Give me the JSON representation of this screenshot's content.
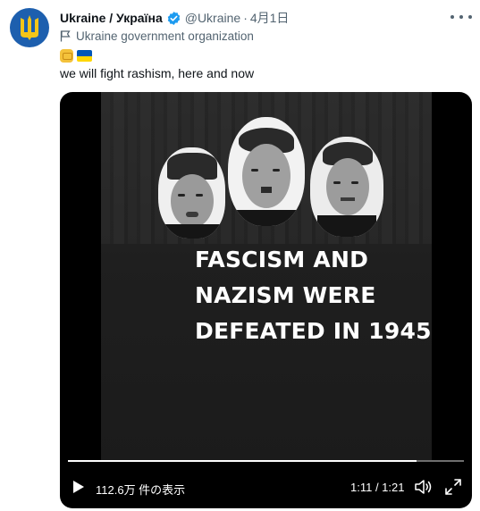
{
  "tweet": {
    "display_name": "Ukraine / Україна",
    "handle": "@Ukraine",
    "separator": "·",
    "date": "4月1日",
    "account_label": "Ukraine government organization",
    "text": "we will fight rashism, here and now",
    "emojis": [
      "raised-fist-emoji",
      "ukraine-flag-emoji"
    ]
  },
  "media": {
    "headline": [
      "FASCISM AND",
      "NAZISM WERE",
      "DEFEATED IN 1945"
    ],
    "views": "112.6万 件の表示",
    "timecode": "1:11 / 1:21",
    "progress_fraction": 0.88
  },
  "colors": {
    "text": "#0f1419",
    "secondary": "#536471",
    "verified": "#1d9bf0",
    "avatar_bg": "#1d5fae",
    "trident": "#f5c518",
    "flag_blue": "#0057b7",
    "flag_yellow": "#ffd700"
  }
}
